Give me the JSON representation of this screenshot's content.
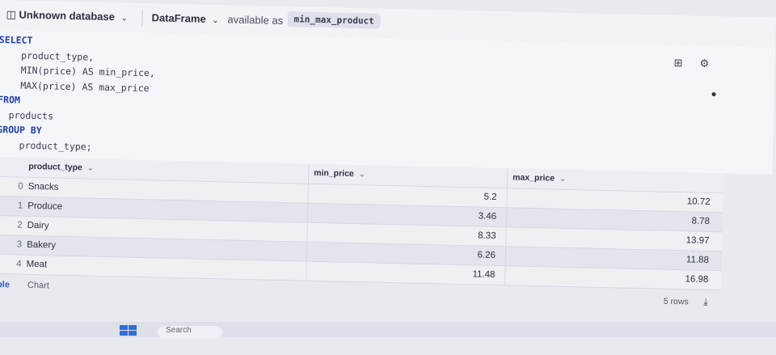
{
  "toolbar": {
    "db_label": "Unknown database",
    "source_label": "DataFrame",
    "available_text": "available as",
    "variable_name": "min_max_product"
  },
  "editor": {
    "lines": [
      "SELECT",
      "    product_type,",
      "    MIN(price) AS min_price,",
      "    MAX(price) AS max_price",
      "FROM",
      "  products",
      "GROUP BY",
      "    product_type;"
    ]
  },
  "table": {
    "columns": [
      "product_type",
      "min_price",
      "max_price"
    ],
    "rows": [
      {
        "index": "0",
        "product_type": "Snacks",
        "min_price": "5.2",
        "max_price": "10.72"
      },
      {
        "index": "1",
        "product_type": "Produce",
        "min_price": "3.46",
        "max_price": "8.78"
      },
      {
        "index": "2",
        "product_type": "Dairy",
        "min_price": "8.33",
        "max_price": "13.97"
      },
      {
        "index": "3",
        "product_type": "Bakery",
        "min_price": "6.26",
        "max_price": "11.88"
      },
      {
        "index": "4",
        "product_type": "Meat",
        "min_price": "11.48",
        "max_price": "16.98"
      }
    ]
  },
  "footer": {
    "table_tab": "Table",
    "chart_tab": "Chart",
    "row_count": "5 rows"
  },
  "taskbar": {
    "search_placeholder": "Search"
  }
}
